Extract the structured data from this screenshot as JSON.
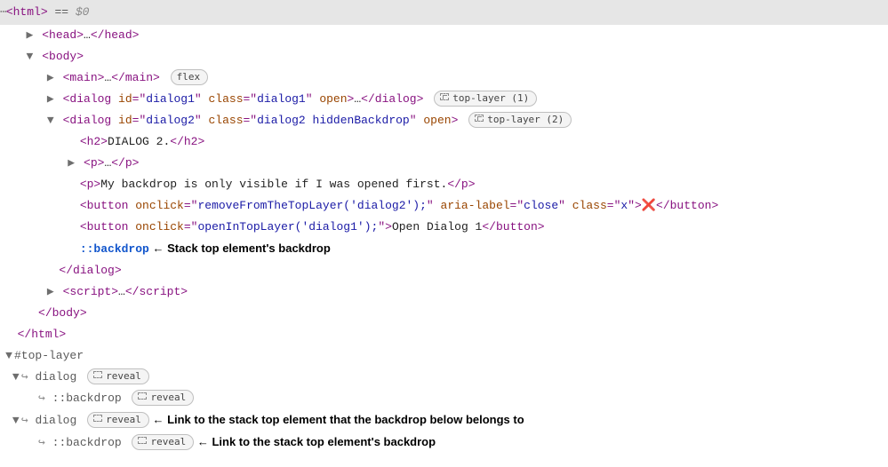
{
  "topbar": {
    "dots": "⋯",
    "html_open": "<html>",
    "eq": " == ",
    "dollar": "$0"
  },
  "lines": {
    "head_open": "<head>",
    "head_ell": "…",
    "head_close": "</head>",
    "body_open": "<body>",
    "main_open": "<main>",
    "main_ell": "…",
    "main_close": "</main>",
    "flex_badge": "flex",
    "dlg1_open1": "<dialog ",
    "id_attr": "id",
    "eq_q": "=\"",
    "dlg1_id": "dialog1",
    "q_sp": "\" ",
    "class_attr": "class",
    "dlg1_class": "dialog1",
    "q_sp2": "\" ",
    "open_attr": "open",
    "dlg1_close1": ">",
    "dlg1_ell": "…",
    "dlg1_close2": "</dialog>",
    "top1_badge": "top-layer (1)",
    "dlg2_id": "dialog2",
    "dlg2_class": "dialog2 hiddenBackdrop",
    "top2_badge": "top-layer (2)",
    "h2_open": "<h2>",
    "h2_text": "DIALOG 2.",
    "h2_close": "</h2>",
    "p_open": "<p>",
    "p_ell": "…",
    "p_close": "</p>",
    "p2_text": "My backdrop is only visible if I was opened first.",
    "btn_open": "<button ",
    "onclick_attr": "onclick",
    "btn1_onclick": "removeFromTheTopLayer('dialog2');",
    "aria_attr": "aria-label",
    "aria_val": "close",
    "btn1_class": "x",
    "btn_close_gt": ">",
    "redx": "❌",
    "btn_close": "</button>",
    "btn2_onclick": "openInTopLayer('dialog1');",
    "btn2_text": "Open Dialog 1",
    "backdrop": "::backdrop",
    "arrow_left": " ← ",
    "anno1": "Stack top element's backdrop",
    "dialog_close": "</dialog>",
    "script_open": "<script>",
    "script_ell": "…",
    "script_close_tag": "</script>",
    "body_close": "</body>",
    "html_close": "</html>"
  },
  "toplayer": {
    "header": "#top-layer",
    "return_arrow": "↪",
    "item_dialog": "dialog",
    "item_backdrop": "::backdrop",
    "reveal": "reveal",
    "anno_link_elem": "Link to the stack top element that the backdrop below belongs to",
    "anno_link_backdrop": "Link to the stack top element's backdrop"
  }
}
